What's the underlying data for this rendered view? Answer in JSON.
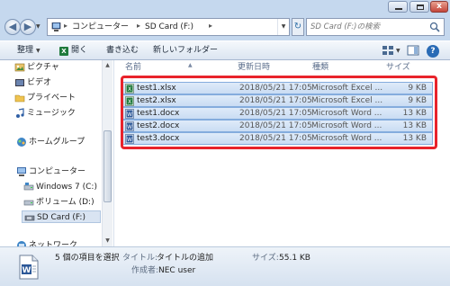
{
  "window": {
    "minimize_label": "",
    "maximize_label": "",
    "close_label": "x"
  },
  "address": {
    "crumbs": [
      "コンピューター",
      "SD Card (F:)"
    ],
    "search_placeholder": "SD Card (F:)の検索"
  },
  "toolbar": {
    "organize": "整理",
    "open": "開く",
    "write": "書き込む",
    "new_folder": "新しいフォルダー",
    "help": "?"
  },
  "nav": {
    "items": [
      {
        "label": "ピクチャ",
        "icon": "pictures-icon"
      },
      {
        "label": "ビデオ",
        "icon": "videos-icon"
      },
      {
        "label": "プライベート",
        "icon": "folder-icon"
      },
      {
        "label": "ミュージック",
        "icon": "music-icon"
      },
      {
        "label": "ホームグループ",
        "icon": "homegroup-icon"
      },
      {
        "label": "コンピューター",
        "icon": "computer-icon"
      },
      {
        "label": "Windows 7 (C:)",
        "icon": "drive-icon"
      },
      {
        "label": "ボリューム (D:)",
        "icon": "drive-icon"
      },
      {
        "label": "SD Card (F:)",
        "icon": "sdcard-icon"
      },
      {
        "label": "ネットワーク",
        "icon": "network-icon"
      }
    ]
  },
  "columns": {
    "name": "名前",
    "date": "更新日時",
    "type": "種類",
    "size": "サイズ"
  },
  "files": [
    {
      "name": "test1.xlsx",
      "date": "2018/05/21 17:05",
      "type": "Microsoft Excel ...",
      "size": "9 KB",
      "kind": "excel"
    },
    {
      "name": "test2.xlsx",
      "date": "2018/05/21 17:05",
      "type": "Microsoft Excel ...",
      "size": "9 KB",
      "kind": "excel"
    },
    {
      "name": "test1.docx",
      "date": "2018/05/21 17:05",
      "type": "Microsoft Word ...",
      "size": "13 KB",
      "kind": "word"
    },
    {
      "name": "test2.docx",
      "date": "2018/05/21 17:05",
      "type": "Microsoft Word ...",
      "size": "13 KB",
      "kind": "word"
    },
    {
      "name": "test3.docx",
      "date": "2018/05/21 17:05",
      "type": "Microsoft Word ...",
      "size": "13 KB",
      "kind": "word"
    }
  ],
  "details": {
    "selection": "5 個の項目を選択",
    "title_label": "タイトル:",
    "title_value": "タイトルの追加",
    "author_label": "作成者:",
    "author_value": "NEC user",
    "size_label": "サイズ:",
    "size_value": "55.1 KB"
  },
  "colors": {
    "highlight_border": "#e8232b",
    "selection_fill": "#c9dcf3",
    "excel_green": "#1f7a3c",
    "word_blue": "#2b5797"
  }
}
